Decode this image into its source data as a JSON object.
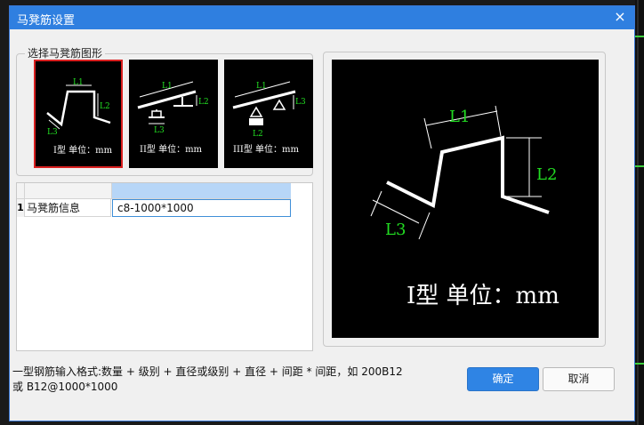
{
  "colors": {
    "title_bar": "#2f7fe0",
    "accent": "#2f84e4",
    "selection_border": "#d92020",
    "drawing_line": "#ffffff",
    "dimension_text": "#22dd22"
  },
  "dialog": {
    "title": "马凳筋设置",
    "close_icon": "×"
  },
  "shape_group": {
    "label": "选择马凳筋图形",
    "options": [
      {
        "id": "I",
        "caption": "I型 单位：mm",
        "selected": true
      },
      {
        "id": "II",
        "caption": "II型 单位：mm",
        "selected": false
      },
      {
        "id": "III",
        "caption": "III型 单位：mm",
        "selected": false
      }
    ]
  },
  "dim_labels": {
    "l1": "L1",
    "l2": "L2",
    "l3": "L3"
  },
  "grid": {
    "rows": [
      {
        "num": "1",
        "name": "马凳筋信息",
        "value": "c8-1000*1000"
      }
    ]
  },
  "preview": {
    "caption": "I型 单位：mm"
  },
  "hint": {
    "line1": "一型钢筋输入格式:数量 + 级别 + 直径或级别 + 直径 + 间距 * 间距，如 200B12",
    "line2": "或 B12@1000*1000"
  },
  "buttons": {
    "ok": "确定",
    "cancel": "取消"
  }
}
